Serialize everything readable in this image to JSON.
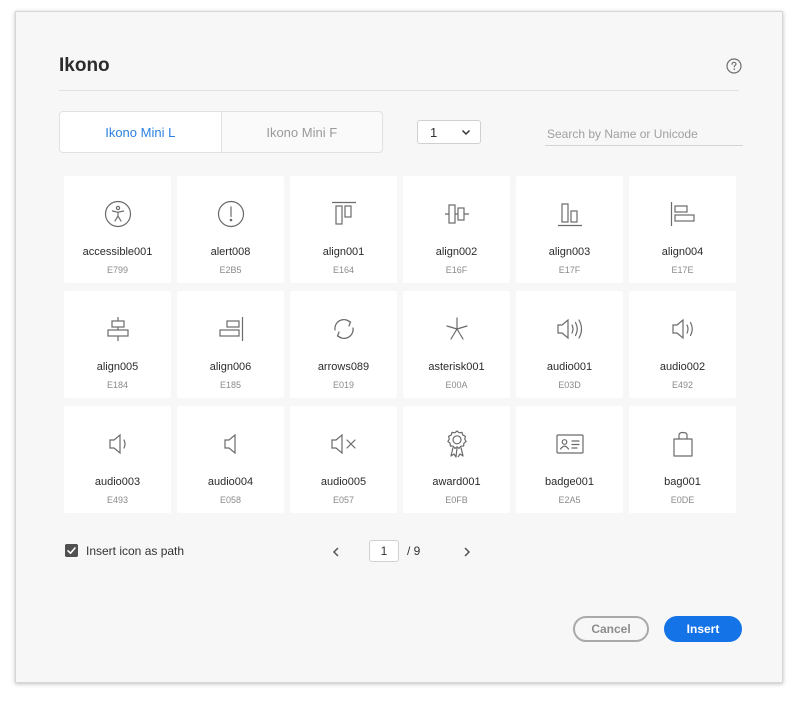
{
  "dialog": {
    "title": "Ikono",
    "help_icon": "help-circle-icon"
  },
  "tabs": [
    {
      "label": "Ikono Mini  L",
      "active": true
    },
    {
      "label": "Ikono Mini  F",
      "active": false
    }
  ],
  "page_select": {
    "value": "1"
  },
  "search": {
    "placeholder": "Search by Name or Unicode",
    "value": ""
  },
  "icons": [
    {
      "name": "accessible001",
      "code": "E799",
      "icon": "accessible-icon"
    },
    {
      "name": "alert008",
      "code": "E2B5",
      "icon": "alert-icon"
    },
    {
      "name": "align001",
      "code": "E164",
      "icon": "align-top-icon"
    },
    {
      "name": "align002",
      "code": "E16F",
      "icon": "align-vertical-center-icon"
    },
    {
      "name": "align003",
      "code": "E17F",
      "icon": "align-bottom-icon"
    },
    {
      "name": "align004",
      "code": "E17E",
      "icon": "align-left-icon"
    },
    {
      "name": "align005",
      "code": "E184",
      "icon": "align-horizontal-center-icon"
    },
    {
      "name": "align006",
      "code": "E185",
      "icon": "align-right-icon"
    },
    {
      "name": "arrows089",
      "code": "E019",
      "icon": "refresh-arrows-icon"
    },
    {
      "name": "asterisk001",
      "code": "E00A",
      "icon": "asterisk-icon"
    },
    {
      "name": "audio001",
      "code": "E03D",
      "icon": "speaker-loud-icon"
    },
    {
      "name": "audio002",
      "code": "E492",
      "icon": "speaker-medium-icon"
    },
    {
      "name": "audio003",
      "code": "E493",
      "icon": "speaker-low-icon"
    },
    {
      "name": "audio004",
      "code": "E058",
      "icon": "speaker-icon"
    },
    {
      "name": "audio005",
      "code": "E057",
      "icon": "speaker-mute-icon"
    },
    {
      "name": "award001",
      "code": "E0FB",
      "icon": "award-icon"
    },
    {
      "name": "badge001",
      "code": "E2A5",
      "icon": "id-badge-icon"
    },
    {
      "name": "bag001",
      "code": "E0DE",
      "icon": "bag-icon"
    }
  ],
  "options": {
    "insert_as_path_label": "Insert icon as path",
    "insert_as_path_checked": true
  },
  "pager": {
    "current": "1",
    "total_label": "/ 9"
  },
  "actions": {
    "cancel_label": "Cancel",
    "insert_label": "Insert"
  },
  "colors": {
    "accent": "#1473e6",
    "active_tab": "#2b82e0"
  }
}
